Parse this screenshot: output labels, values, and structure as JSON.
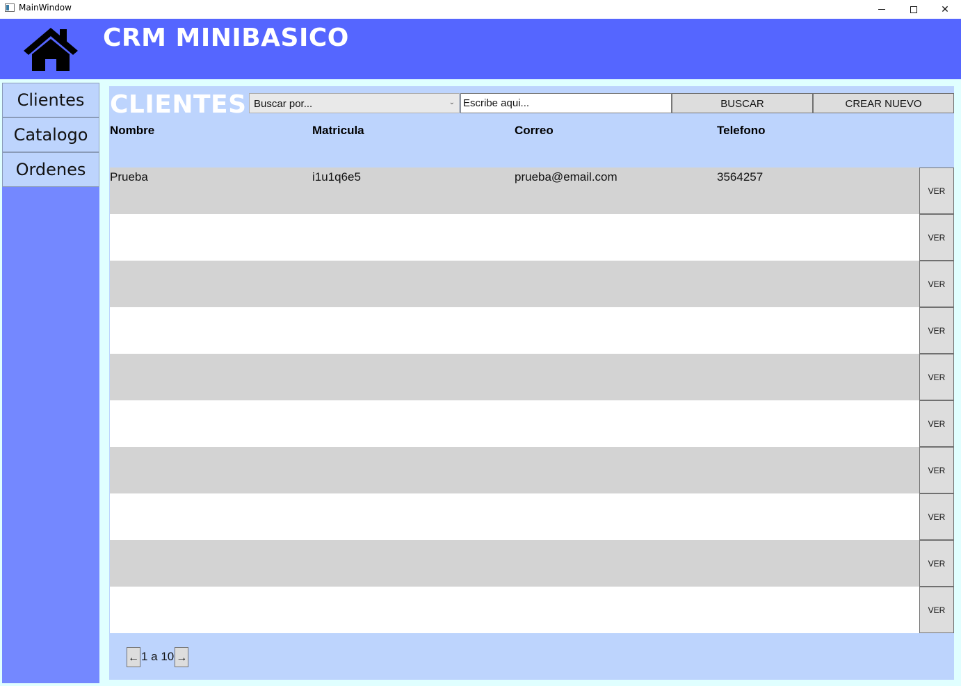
{
  "window": {
    "title": "MainWindow",
    "minimize_label": "",
    "close_symbol": "✕"
  },
  "header": {
    "brand": "CRM MINIBASICO",
    "home_icon": "home-icon"
  },
  "sidebar": {
    "items": [
      {
        "label": "Clientes"
      },
      {
        "label": "Catalogo"
      },
      {
        "label": "Ordenes"
      }
    ]
  },
  "main": {
    "title": "CLIENTES",
    "search_by": {
      "selected": "Buscar por...",
      "arrow": "⌄"
    },
    "search_input": {
      "placeholder": "Escribe aqui..."
    },
    "buscar_label": "BUSCAR",
    "crear_label": "CREAR NUEVO"
  },
  "table": {
    "columns": [
      "Nombre",
      "Matricula",
      "Correo",
      "Telefono"
    ],
    "rows": [
      {
        "nombre": "Prueba",
        "matricula": "i1u1q6e5",
        "correo": "prueba@email.com",
        "telefono": "3564257",
        "action": "VER"
      },
      {
        "nombre": "",
        "matricula": "",
        "correo": "",
        "telefono": "",
        "action": "VER"
      },
      {
        "nombre": "",
        "matricula": "",
        "correo": "",
        "telefono": "",
        "action": "VER"
      },
      {
        "nombre": "",
        "matricula": "",
        "correo": "",
        "telefono": "",
        "action": "VER"
      },
      {
        "nombre": "",
        "matricula": "",
        "correo": "",
        "telefono": "",
        "action": "VER"
      },
      {
        "nombre": "",
        "matricula": "",
        "correo": "",
        "telefono": "",
        "action": "VER"
      },
      {
        "nombre": "",
        "matricula": "",
        "correo": "",
        "telefono": "",
        "action": "VER"
      },
      {
        "nombre": "",
        "matricula": "",
        "correo": "",
        "telefono": "",
        "action": "VER"
      },
      {
        "nombre": "",
        "matricula": "",
        "correo": "",
        "telefono": "",
        "action": "VER"
      },
      {
        "nombre": "",
        "matricula": "",
        "correo": "",
        "telefono": "",
        "action": "VER"
      }
    ]
  },
  "pager": {
    "prev": "←",
    "range": "1 a 10",
    "next": "→"
  },
  "colors": {
    "header_bg": "#5566ff",
    "sidebar_bg": "#7488ff",
    "panel_bg": "#bdd4fd",
    "row_alt": "#d3d3d3"
  }
}
